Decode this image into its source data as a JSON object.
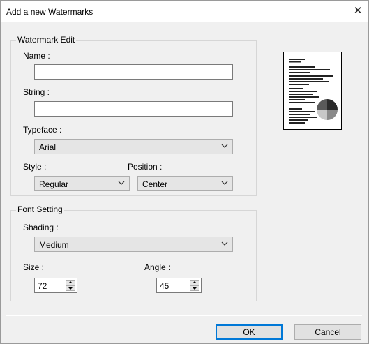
{
  "window": {
    "title": "Add a new Watermarks",
    "close_glyph": "✕"
  },
  "watermark_edit": {
    "group_label": "Watermark Edit",
    "name_label": "Name :",
    "name_value": "",
    "string_label": "String :",
    "string_value": "",
    "typeface_label": "Typeface :",
    "typeface_value": "Arial",
    "style_label": "Style :",
    "style_value": "Regular",
    "position_label": "Position :",
    "position_value": "Center"
  },
  "font_setting": {
    "group_label": "Font Setting",
    "shading_label": "Shading :",
    "shading_value": "Medium",
    "size_label": "Size :",
    "size_value": "72",
    "angle_label": "Angle :",
    "angle_value": "45"
  },
  "buttons": {
    "ok": "OK",
    "cancel": "Cancel"
  },
  "icons": {
    "close": "close-icon",
    "dropdown": "chevron-down-icon",
    "spin_up": "spin-up-icon",
    "spin_down": "spin-down-icon"
  },
  "colors": {
    "window_bg": "#f0f0f0",
    "accent": "#0078d7",
    "preview_pie": [
      "#2b2b2b",
      "#8a8a8a",
      "#c8c8c8",
      "#5a5a5a"
    ]
  }
}
